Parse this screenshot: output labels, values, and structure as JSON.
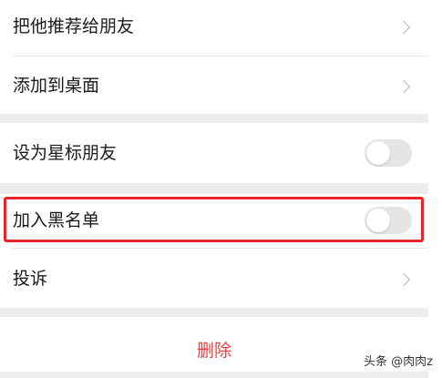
{
  "menu": {
    "recommend_label": "把他推荐给朋友",
    "add_desktop_label": "添加到桌面",
    "star_friend_label": "设为星标朋友",
    "star_friend_enabled": false,
    "blacklist_label": "加入黑名单",
    "blacklist_enabled": false,
    "complain_label": "投诉",
    "delete_label": "删除"
  },
  "watermark": {
    "text": "头条 @肉肉z"
  },
  "colors": {
    "highlight_border": "#e8252b",
    "delete_text": "#e64340",
    "section_gap": "#ededed",
    "toggle_off": "#e5e5e5"
  },
  "icons": {
    "chevron": "chevron-right-icon"
  }
}
